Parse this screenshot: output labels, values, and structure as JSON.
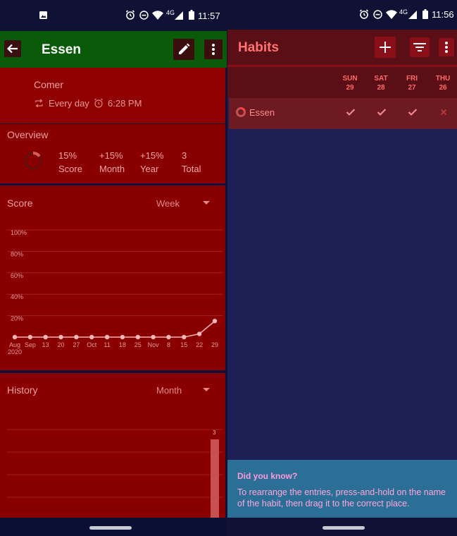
{
  "left": {
    "status_time": "11:57",
    "status_net": "4G",
    "title": "Essen",
    "habit_question": "Comer",
    "frequency": "Every day",
    "reminder": "6:28 PM",
    "overview": {
      "header": "Overview",
      "ring_score": 0.15,
      "stats": [
        {
          "value": "15%",
          "label": "Score"
        },
        {
          "value": "+15%",
          "label": "Month"
        },
        {
          "value": "+15%",
          "label": "Year"
        },
        {
          "value": "3",
          "label": "Total"
        }
      ]
    },
    "score": {
      "header": "Score",
      "period": "Week"
    },
    "history": {
      "header": "History",
      "period": "Month",
      "bar_label": "3"
    }
  },
  "chart_data": {
    "type": "line",
    "title": "Score",
    "y_ticks": [
      "100%",
      "80%",
      "60%",
      "40%",
      "20%"
    ],
    "x_labels": [
      "Aug",
      "Sep",
      "13",
      "20",
      "27",
      "Oct",
      "11",
      "18",
      "25",
      "Nov",
      "8",
      "15",
      "22",
      "29"
    ],
    "x_year": "2020",
    "ylim": [
      0,
      100
    ],
    "values": [
      0,
      0,
      0,
      0,
      0,
      0,
      0,
      0,
      0,
      0,
      0,
      0,
      3,
      15
    ]
  },
  "right": {
    "status_time": "11:56",
    "status_net": "4G",
    "title": "Habits",
    "days": [
      {
        "name": "SUN",
        "num": "29"
      },
      {
        "name": "SAT",
        "num": "28"
      },
      {
        "name": "FRI",
        "num": "27"
      },
      {
        "name": "THU",
        "num": "26"
      }
    ],
    "habit": {
      "name": "Essen",
      "checks": [
        "check",
        "check",
        "check",
        "cross"
      ]
    },
    "tip": {
      "title": "Did you know?",
      "body": "To rearrange the entries, press-and-hold on the name of the habit, then drag it to the correct place."
    }
  }
}
